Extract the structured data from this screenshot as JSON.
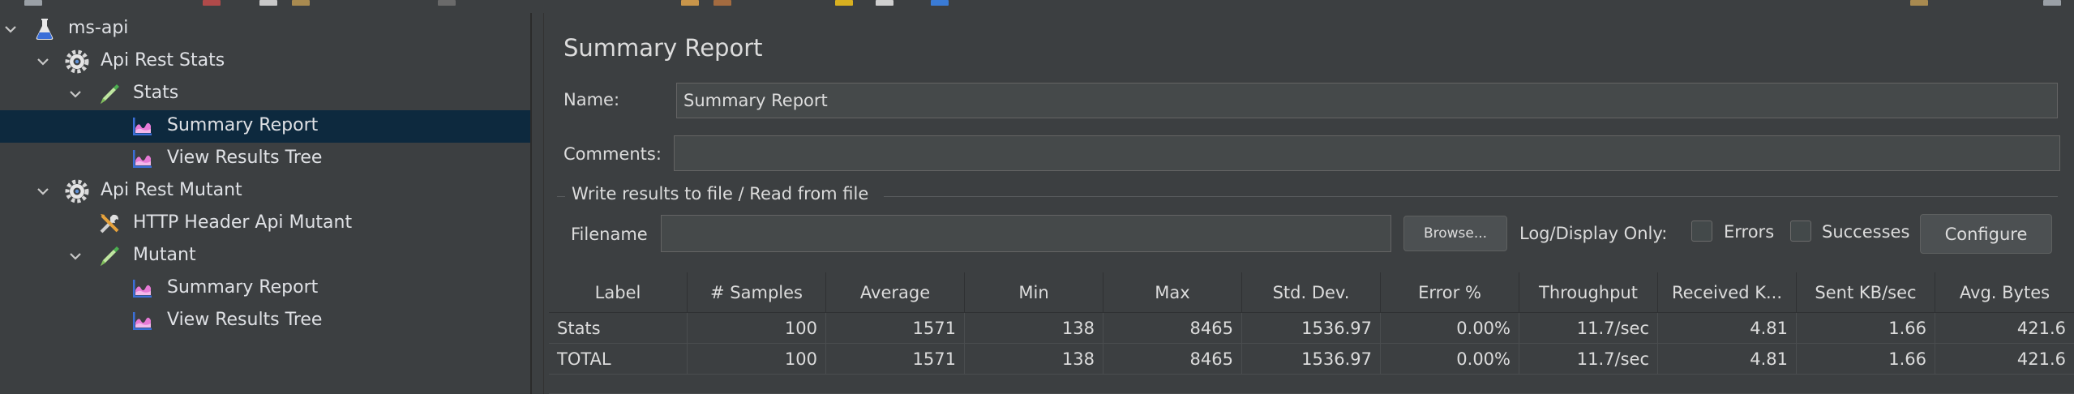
{
  "tree": {
    "items": [
      {
        "label": "ms-api",
        "icon": "flask-icon"
      },
      {
        "label": "Api Rest Stats",
        "icon": "gear-icon"
      },
      {
        "label": "Stats",
        "icon": "pipette-icon"
      },
      {
        "label": "Summary Report",
        "icon": "chart-icon"
      },
      {
        "label": "View Results Tree",
        "icon": "chart-icon"
      },
      {
        "label": "Api Rest Mutant",
        "icon": "gear-icon"
      },
      {
        "label": "HTTP Header Api Mutant",
        "icon": "tools-icon"
      },
      {
        "label": "Mutant",
        "icon": "pipette-icon"
      },
      {
        "label": "Summary Report",
        "icon": "chart-icon"
      },
      {
        "label": "View Results Tree",
        "icon": "chart-icon"
      }
    ]
  },
  "panel": {
    "title": "Summary Report",
    "name_label": "Name:",
    "name_value": "Summary Report",
    "comments_label": "Comments:",
    "comments_value": "",
    "group_title": "Write results to file / Read from file",
    "filename_label": "Filename",
    "filename_value": "",
    "browse_label": "Browse...",
    "log_display_label": "Log/Display Only:",
    "errors_label": "Errors",
    "successes_label": "Successes",
    "configure_label": "Configure"
  },
  "table": {
    "headers": [
      "Label",
      "# Samples",
      "Average",
      "Min",
      "Max",
      "Std. Dev.",
      "Error %",
      "Throughput",
      "Received K...",
      "Sent KB/sec",
      "Avg. Bytes"
    ],
    "rows": [
      [
        "Stats",
        "100",
        "1571",
        "138",
        "8465",
        "1536.97",
        "0.00%",
        "11.7/sec",
        "4.81",
        "1.66",
        "421.6"
      ],
      [
        "TOTAL",
        "100",
        "1571",
        "138",
        "8465",
        "1536.97",
        "0.00%",
        "11.7/sec",
        "4.81",
        "1.66",
        "421.6"
      ]
    ]
  },
  "colors": {
    "background": "#3c3f41",
    "selection": "#0d293e",
    "field": "#45494a",
    "text": "#dcdcdc"
  }
}
